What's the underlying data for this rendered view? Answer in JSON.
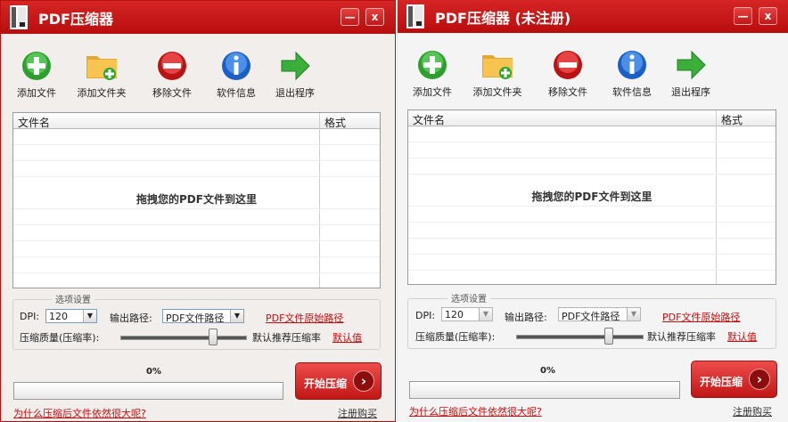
{
  "windows": [
    {
      "title": "PDF压缩器",
      "title_controls": {
        "minimize": "—",
        "close": "x"
      },
      "toolbar": [
        {
          "label": "添加文件",
          "icon": "green-plus-icon"
        },
        {
          "label": "添加文件夹",
          "icon": "folder-add-icon"
        },
        {
          "label": "移除文件",
          "icon": "red-minus-icon"
        },
        {
          "label": "软件信息",
          "icon": "info-icon"
        },
        {
          "label": "退出程序",
          "icon": "green-arrow-icon"
        }
      ],
      "file_list": {
        "columns": [
          "文件名",
          "格式"
        ],
        "placeholder": "拖拽您的PDF文件到这里"
      },
      "options": {
        "legend": "选项设置",
        "dpi_label": "DPI:",
        "dpi_value": "120",
        "output_label": "输出路径:",
        "output_value": "PDF文件路径",
        "output_link": "PDF文件原始路径",
        "quality_label": "压缩质量(压缩率):",
        "quality_text": "默认推荐压缩率",
        "default_link": "默认值"
      },
      "progress": {
        "text": "0%",
        "value": 0
      },
      "start_button": "开始压缩",
      "footer": {
        "why_link": "为什么压缩后文件依然很大呢?",
        "register_link": "注册购买"
      }
    },
    {
      "title": "PDF压缩器 (未注册)",
      "title_controls": {
        "minimize": "—",
        "close": "x"
      },
      "toolbar": [
        {
          "label": "添加文件",
          "icon": "green-plus-icon"
        },
        {
          "label": "添加文件夹",
          "icon": "folder-add-icon"
        },
        {
          "label": "移除文件",
          "icon": "red-minus-icon"
        },
        {
          "label": "软件信息",
          "icon": "info-icon"
        },
        {
          "label": "退出程序",
          "icon": "green-arrow-icon"
        }
      ],
      "file_list": {
        "columns": [
          "文件名",
          "格式"
        ],
        "placeholder": "拖拽您的PDF文件到这里"
      },
      "options": {
        "legend": "选项设置",
        "dpi_label": "DPI:",
        "dpi_value": "120",
        "output_label": "输出路径:",
        "output_value": "PDF文件路径",
        "output_link": "PDF文件原始路径",
        "quality_label": "压缩质量(压缩率):",
        "quality_text": "默认推荐压缩率",
        "default_link": "默认值"
      },
      "progress": {
        "text": "0%",
        "value": 0
      },
      "start_button": "开始压缩",
      "footer": {
        "why_link": "为什么压缩后文件依然很大呢?",
        "register_link": "注册购买"
      }
    }
  ],
  "colors": {
    "titlebar": "#c81b1b",
    "link": "#c40e0e",
    "start_button": "#d62a2a",
    "window_border": "#b80f0f"
  }
}
